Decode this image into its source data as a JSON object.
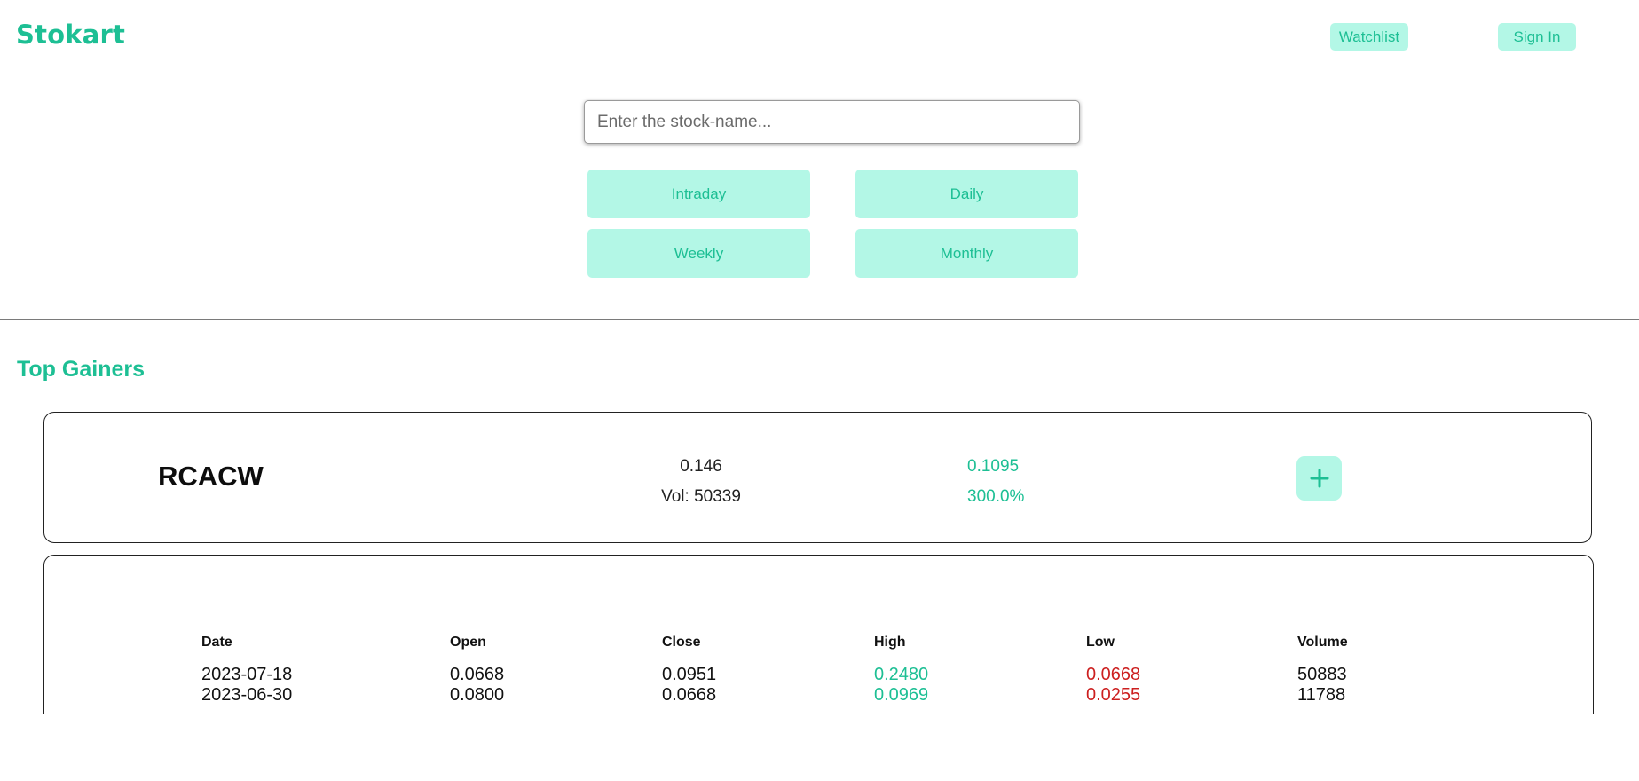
{
  "app": {
    "brand": "Stokart"
  },
  "nav": {
    "watchlist": "Watchlist",
    "sign_in": "Sign In"
  },
  "search": {
    "placeholder": "Enter the stock-name...",
    "value": ""
  },
  "period_buttons": {
    "intraday": "Intraday",
    "daily": "Daily",
    "weekly": "Weekly",
    "monthly": "Monthly"
  },
  "section": {
    "title": "Top Gainers"
  },
  "gainer": {
    "ticker": "RCACW",
    "price": "0.146",
    "volume": "Vol: 50339",
    "change": "0.1095",
    "change_percent": "300.0%"
  },
  "history": {
    "columns": [
      "Date",
      "Open",
      "Close",
      "High",
      "Low",
      "Volume"
    ],
    "rows": [
      [
        "2023-07-18",
        "0.0668",
        "0.0951",
        "0.2480",
        "0.0668",
        "50883"
      ],
      [
        "2023-06-30",
        "0.0800",
        "0.0668",
        "0.0969",
        "0.0255",
        "11788"
      ]
    ]
  },
  "colors": {
    "accent": "#1dbf94",
    "accent_bg": "#b3f7e6",
    "high": "#1dbf94",
    "low": "#cc1f1f"
  },
  "icons": {
    "add": "plus-icon"
  }
}
